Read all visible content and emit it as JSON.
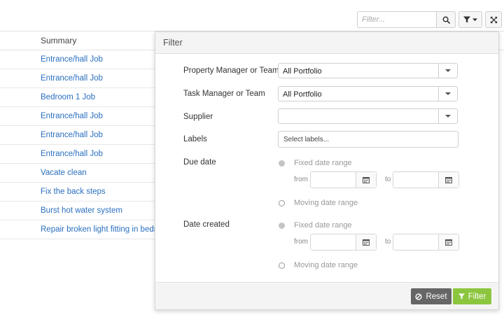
{
  "toolbar": {
    "search_placeholder": "Filter...",
    "search_icon": "search-icon",
    "filter_icon": "filter-icon",
    "expand_icon": "expand-icon"
  },
  "table": {
    "column_header": "Summary",
    "rows": [
      "Entrance/hall Job",
      "Entrance/hall Job",
      "Bedroom 1 Job",
      "Entrance/hall Job",
      "Entrance/hall Job",
      "Entrance/hall Job",
      "Vacate clean",
      "Fix the back steps",
      "Burst hot water system",
      "Repair broken light fitting in bedro..."
    ]
  },
  "filter_panel": {
    "title": "Filter",
    "property_manager": {
      "label": "Property Manager or Team",
      "value": "All Portfolio"
    },
    "task_manager": {
      "label": "Task Manager or Team",
      "value": "All Portfolio"
    },
    "supplier": {
      "label": "Supplier",
      "value": ""
    },
    "labels": {
      "label": "Labels",
      "placeholder": "Select labels..."
    },
    "due_date": {
      "label": "Due date",
      "fixed_label": "Fixed date range",
      "from_label": "from",
      "to_label": "to",
      "moving_label": "Moving date range"
    },
    "date_created": {
      "label": "Date created",
      "fixed_label": "Fixed date range",
      "from_label": "from",
      "to_label": "to",
      "moving_label": "Moving date range"
    },
    "reset_label": "Reset",
    "apply_label": "Filter"
  },
  "colors": {
    "link": "#2a6fbf",
    "reset_button": "#666666",
    "filter_button": "#8cc63f"
  }
}
